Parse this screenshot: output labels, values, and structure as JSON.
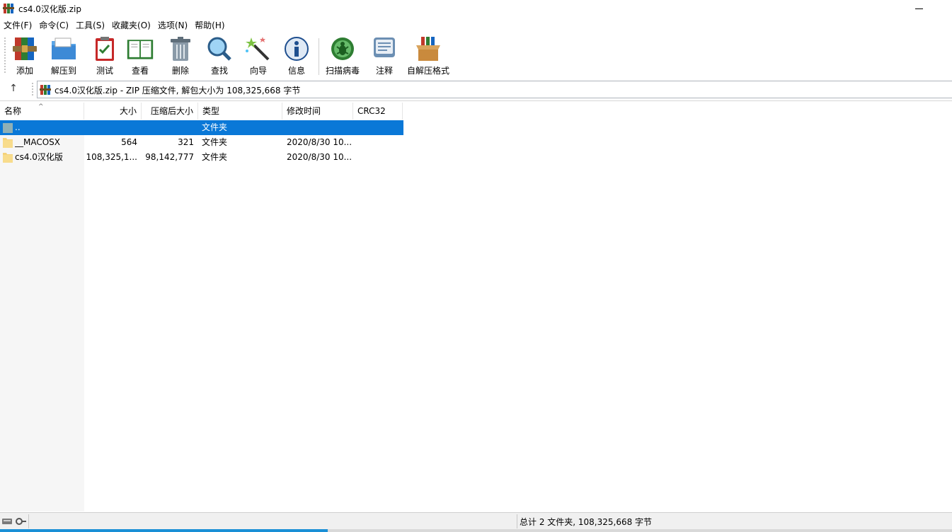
{
  "window": {
    "title": "cs4.0汉化版.zip"
  },
  "menu": [
    {
      "label": "文件(F)"
    },
    {
      "label": "命令(C)"
    },
    {
      "label": "工具(S)"
    },
    {
      "label": "收藏夹(O)"
    },
    {
      "label": "选项(N)"
    },
    {
      "label": "帮助(H)"
    }
  ],
  "toolbar": [
    {
      "label": "添加",
      "icon": "add-archive-icon"
    },
    {
      "label": "解压到",
      "icon": "extract-to-icon"
    },
    {
      "label": "测试",
      "icon": "test-icon"
    },
    {
      "label": "查看",
      "icon": "view-book-icon"
    },
    {
      "label": "删除",
      "icon": "trash-icon"
    },
    {
      "label": "查找",
      "icon": "find-magnifier-icon"
    },
    {
      "label": "向导",
      "icon": "wizard-wand-icon"
    },
    {
      "label": "信息",
      "icon": "info-icon"
    },
    {
      "label": "扫描病毒",
      "icon": "virus-scan-icon"
    },
    {
      "label": "注释",
      "icon": "comment-icon"
    },
    {
      "label": "自解压格式",
      "icon": "sfx-box-icon"
    }
  ],
  "address": {
    "text": "cs4.0汉化版.zip - ZIP 压缩文件, 解包大小为 108,325,668 字节"
  },
  "columns": {
    "name": "名称",
    "size": "大小",
    "packed": "压缩后大小",
    "type": "类型",
    "modified": "修改时间",
    "crc": "CRC32"
  },
  "rows": [
    {
      "name": "..",
      "size": "",
      "packed": "",
      "type": "文件夹",
      "modified": "",
      "crc": ""
    },
    {
      "name": "__MACOSX",
      "size": "564",
      "packed": "321",
      "type": "文件夹",
      "modified": "2020/8/30 10...",
      "crc": ""
    },
    {
      "name": "cs4.0汉化版",
      "size": "108,325,1...",
      "packed": "98,142,777",
      "type": "文件夹",
      "modified": "2020/8/30 10...",
      "crc": ""
    }
  ],
  "status": {
    "text": "总计 2 文件夹, 108,325,668 字节"
  },
  "colors": {
    "selection": "#0a78d7",
    "folder": "#f5d27a",
    "accent": "#1a8fd6"
  }
}
